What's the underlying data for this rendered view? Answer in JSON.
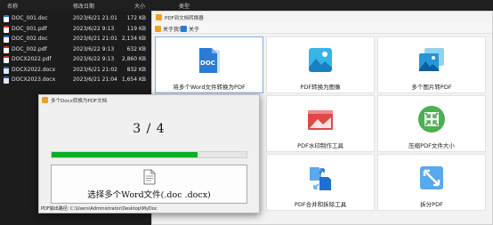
{
  "explorer": {
    "columns": {
      "name": "名称",
      "modified": "修改日期",
      "size": "大小",
      "type": "类型"
    },
    "files": [
      {
        "name": "DOC_001.doc",
        "date": "2023/6/21 21:01",
        "size": "172 KB",
        "kind": "doc"
      },
      {
        "name": "DOC_001.pdf",
        "date": "2023/6/22 9:13",
        "size": "119 KB",
        "kind": "pdf"
      },
      {
        "name": "DOC_002.doc",
        "date": "2023/6/21 21:01",
        "size": "2,134 KB",
        "kind": "doc"
      },
      {
        "name": "DOC_002.pdf",
        "date": "2023/6/22 9:13",
        "size": "632 KB",
        "kind": "pdf"
      },
      {
        "name": "DOCX2022.pdf",
        "date": "2023/6/22 9:13",
        "size": "2,860 KB",
        "kind": "pdf"
      },
      {
        "name": "DOCX2022.docx",
        "date": "2023/6/21 21:02",
        "size": "832 KB",
        "kind": "docx"
      },
      {
        "name": "DOCX2023.docx",
        "date": "2023/6/21 21:04",
        "size": "1,654 KB",
        "kind": "docx"
      }
    ]
  },
  "main_window": {
    "title": "PDF到文档转换器",
    "menu": {
      "about_us": "关于我们",
      "about": "关于"
    },
    "tiles": [
      {
        "label": "将多个Word文件转换为PDF",
        "icon": "doc-icon"
      },
      {
        "label": "PDF转换为图像",
        "icon": "image-icon"
      },
      {
        "label": "多个图片转PDF",
        "icon": "images-icon"
      },
      {
        "label": "PDF水印制作工具",
        "icon": "watermark-icon"
      },
      {
        "label": "压缩PDF文件大小",
        "icon": "compress-icon"
      },
      {
        "label": "PDF合并和拆除工具",
        "icon": "merge-icon"
      },
      {
        "label": "拆分PDF",
        "icon": "split-icon"
      }
    ]
  },
  "dialog": {
    "title": "多个Docx转换为PDF文档",
    "counter": "3 / 4",
    "progress": 0.75,
    "select_button": "选择多个Word文件(.doc .docx)",
    "output_path": "PDF输出路径: C:\\Users\\Administrator\\Desktop\\MyDoc"
  },
  "colors": {
    "accent": "#2b7bd6",
    "progress": "#06b025",
    "watermark": "#e04848",
    "compress": "#4caf50"
  }
}
